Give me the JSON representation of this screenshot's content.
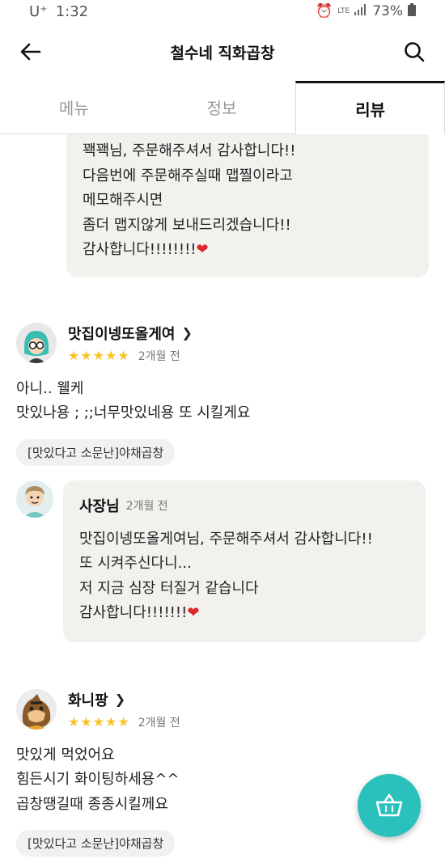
{
  "status": {
    "carrier": "U⁺",
    "time": "1:32",
    "network": "LTE",
    "battery": "73%"
  },
  "header": {
    "title": "철수네 직화곱창"
  },
  "tabs": [
    {
      "label": "메뉴"
    },
    {
      "label": "정보"
    },
    {
      "label": "리뷰"
    }
  ],
  "top_reply": {
    "text": "꽥꽥님, 주문해주셔서 감사합니다!!\n다음번에 주문해주실때 맵찔이라고\n메모해주시면\n좀더 맵지않게 보내드리겠습니다!!\n감사합니다!!!!!!!!"
  },
  "reviews": [
    {
      "author": "맛집이넹또올게여",
      "rating": "★★★★★",
      "date": "2개월 전",
      "text": "아니.. 웰케\n맛있나용 ; ;;너무맛있네용 또 시킬게요",
      "menu": "[맛있다고 소문난]야채곱창",
      "reply": {
        "owner": "사장님",
        "date": "2개월 전",
        "text": "맛집이넹또올게여님, 주문해주셔서 감사합니다!!\n또 시켜주신다니...\n저 지금 심장 터질거 같습니다\n감사합니다!!!!!!!"
      }
    },
    {
      "author": "화니팡",
      "rating": "★★★★★",
      "date": "2개월 전",
      "text": "맛있게 먹었어요\n힘든시기 화이팅하세용^^\n곱창땡길때 종종시킬께요",
      "menu": "[맛있다고 소문난]야채곱창"
    }
  ],
  "colors": {
    "accent": "#2ac1bc",
    "star": "#f7c325",
    "heart": "#e0262d",
    "bubble": "#f3f1ee"
  }
}
